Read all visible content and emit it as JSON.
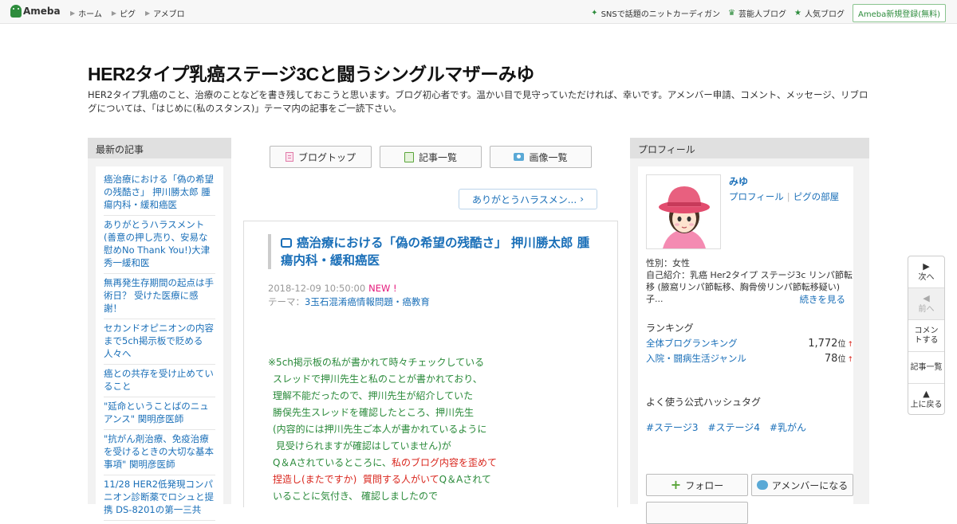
{
  "topbar": {
    "logo": "Ameba",
    "nav": [
      "ホーム",
      "ピグ",
      "アメブロ"
    ],
    "right_links": [
      {
        "icon": "sparkle-icon",
        "label": "SNSで話題のニットカーディガン"
      },
      {
        "icon": "crown-icon",
        "label": "芸能人ブログ"
      },
      {
        "icon": "star-icon",
        "label": "人気ブログ"
      }
    ],
    "signup": "Ameba新規登録(無料)"
  },
  "header": {
    "title": "HER2タイプ乳癌ステージ3Cと闘うシングルマザーみゆ",
    "description": "HER2タイプ乳癌のこと、治療のことなどを書き残しておこうと思います。ブログ初心者です。温かい目で見守っていただければ、幸いです。アメンバー申請、コメント、メッセージ、リブログについては、「はじめに(私のスタンス)」テーマ内の記事をご一読下さい。"
  },
  "left": {
    "heading": "最新の記事",
    "items": [
      "癌治療における「偽の希望の残酷さ」 押川勝太郎 腫瘍内科・緩和癌医",
      "ありがとうハラスメント(善意の押し売り、安易な慰めNo Thank You!)大津秀一緩和医",
      "無再発生存期間の起点は手術日？ 受けた医療に感謝！",
      "セカンドオピニオンの内容まで5ch掲示板で貶める人々へ",
      "癌との共存を受け止めていること",
      "\"延命ということばのニュアンス\" 関明彦医師",
      "\"抗がん剤治療、免疫治療を受けるときの大切な基本事項\" 関明彦医師",
      "11/28 HER2低発現コンパニオン診断薬でロシュと提携 DS-8201の第一三共"
    ]
  },
  "middle": {
    "buttons": [
      "ブログトップ",
      "記事一覧",
      "画像一覧"
    ],
    "next_post": "ありがとうハラスメン...",
    "article": {
      "title": "癌治療における「偽の希望の残酷さ」 押川勝太郎 腫瘍内科・緩和癌医",
      "date": "2018-12-09 10:50:00",
      "new_badge": "NEW !",
      "theme_label": "テーマ：",
      "theme": "3玉石混淆癌情報問題・癌教育",
      "body_lines": [
        "※5ch掲示板の私が書かれて時々チェックしている",
        "スレッドで押川先生と私のことが書かれており、",
        "理解不能だったので、押川先生が紹介していた",
        "勝俣先生スレッドを確認したところ、押川先生",
        "(内容的には押川先生ご本人が書かれているように",
        " 見受けられますが確認はしていません)が",
        "Q＆Aされているところに、",
        "私のブログ内容を歪めて",
        "捏造し(またですか)  質問する人がいて",
        "Q＆Aされて",
        "いることに気付き、 確認しましたので"
      ]
    }
  },
  "right": {
    "heading": "プロフィール",
    "name": "みゆ",
    "links": [
      "プロフィール",
      "ピグの部屋"
    ],
    "gender": "性別：女性",
    "intro": "自己紹介：乳癌 Her2タイプ ステージ3c リンパ節転移 (腋窩リンパ節転移、胸骨傍リンパ節転移疑い) 子...",
    "more": "続きを見る",
    "ranking_title": "ランキング",
    "rankings": [
      {
        "name": "全体ブログランキング",
        "value": "1,772",
        "unit": "位",
        "arrow": "↑"
      },
      {
        "name": "入院・闘病生活ジャンル",
        "value": "78",
        "unit": "位",
        "arrow": "↑"
      }
    ],
    "hashtag_title": "よく使う公式ハッシュタグ",
    "hashtags": [
      "#ステージ3",
      "#ステージ4",
      "#乳がん"
    ],
    "follow": "フォロー",
    "amember": "アメンバーになる"
  },
  "sidenav": {
    "items": [
      {
        "arrow": "▶",
        "label": "次へ"
      },
      {
        "arrow": "◀",
        "label": "前へ"
      },
      {
        "arrow": "",
        "label": "コメントする"
      },
      {
        "arrow": "",
        "label": "記事一覧"
      },
      {
        "arrow": "▲",
        "label": "上に戻る"
      }
    ]
  }
}
